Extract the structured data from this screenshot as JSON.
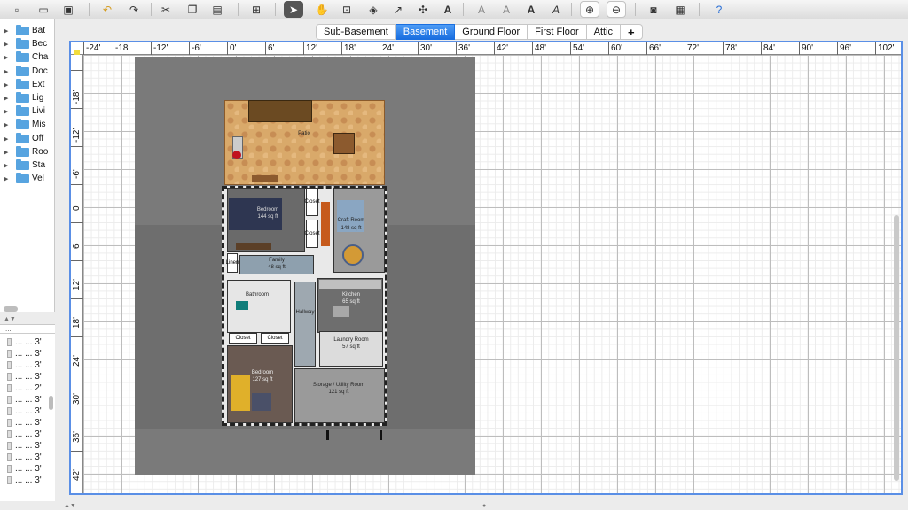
{
  "toolbar": {
    "buttons": [
      "new-icon",
      "open-icon",
      "save-icon",
      "undo-icon",
      "redo-icon",
      "cut-icon",
      "copy-icon",
      "paste-icon",
      "add-furniture-icon",
      "select-icon",
      "pan-icon",
      "create-walls-icon",
      "create-rooms-icon",
      "create-polylines-icon",
      "create-dimensions-icon",
      "add-text-icon",
      "text-style-1-icon",
      "text-style-2-icon",
      "bold-icon",
      "italic-icon",
      "zoom-in-icon",
      "zoom-out-icon",
      "photo-icon",
      "video-icon",
      "help-icon"
    ]
  },
  "catalog": {
    "items": [
      "Bat",
      "Bec",
      "Cha",
      "Doc",
      "Ext",
      "Lig",
      "Livi",
      "Mis",
      "Off",
      "Roo",
      "Sta",
      "Vel"
    ]
  },
  "furniture_list": {
    "header": "...",
    "rows": [
      {
        "name": "... ...",
        "width": "3'"
      },
      {
        "name": "... ...",
        "width": "3'"
      },
      {
        "name": "... ...",
        "width": "3'"
      },
      {
        "name": "... ...",
        "width": "3'"
      },
      {
        "name": "... ...",
        "width": "2'"
      },
      {
        "name": "... ...",
        "width": "3'"
      },
      {
        "name": "... ...",
        "width": "3'"
      },
      {
        "name": "... ...",
        "width": "3'"
      },
      {
        "name": "... ...",
        "width": "3'"
      },
      {
        "name": "... ...",
        "width": "3'"
      },
      {
        "name": "... ...",
        "width": "3'"
      },
      {
        "name": "... ...",
        "width": "3'"
      },
      {
        "name": "... ...",
        "width": "3'"
      }
    ]
  },
  "levels": {
    "tabs": [
      "Sub-Basement",
      "Basement",
      "Ground Floor",
      "First Floor",
      "Attic"
    ],
    "active": "Basement",
    "add_label": "+"
  },
  "ruler": {
    "x_labels": [
      "-24'",
      "-18'",
      "-12'",
      "-6'",
      "0'",
      "6'",
      "12'",
      "18'",
      "24'",
      "30'",
      "36'",
      "42'",
      "48'",
      "54'",
      "60'",
      "66'",
      "72'",
      "78'",
      "84'",
      "90'",
      "96'",
      "102'"
    ],
    "y_labels": [
      "-18'",
      "-12'",
      "-6'",
      "0'",
      "6'",
      "12'",
      "18'",
      "24'",
      "30'",
      "36'",
      "42'"
    ]
  },
  "rooms": {
    "patio": {
      "name": "Patio"
    },
    "bedroom1": {
      "name": "Bedroom",
      "area": "144 sq ft"
    },
    "closet_a": {
      "name": "Closet"
    },
    "closet_b": {
      "name": "Closet"
    },
    "craft": {
      "name": "Craft Room",
      "area": "148 sq ft"
    },
    "linen": {
      "name": "Linen"
    },
    "family": {
      "name": "Family",
      "area": "48 sq ft"
    },
    "bathroom": {
      "name": "Bathroom"
    },
    "kitchen": {
      "name": "Kitchen",
      "area": "65 sq ft"
    },
    "hallway": {
      "name": "Hallway"
    },
    "closet_c": {
      "name": "Closet"
    },
    "closet_d": {
      "name": "Closet"
    },
    "laundry": {
      "name": "Laundry Room",
      "area": "57 sq ft"
    },
    "bedroom2": {
      "name": "Bedroom",
      "area": "127 sq ft"
    },
    "storage": {
      "name": "Storage / Utility Room",
      "area": "121 sq ft"
    }
  }
}
